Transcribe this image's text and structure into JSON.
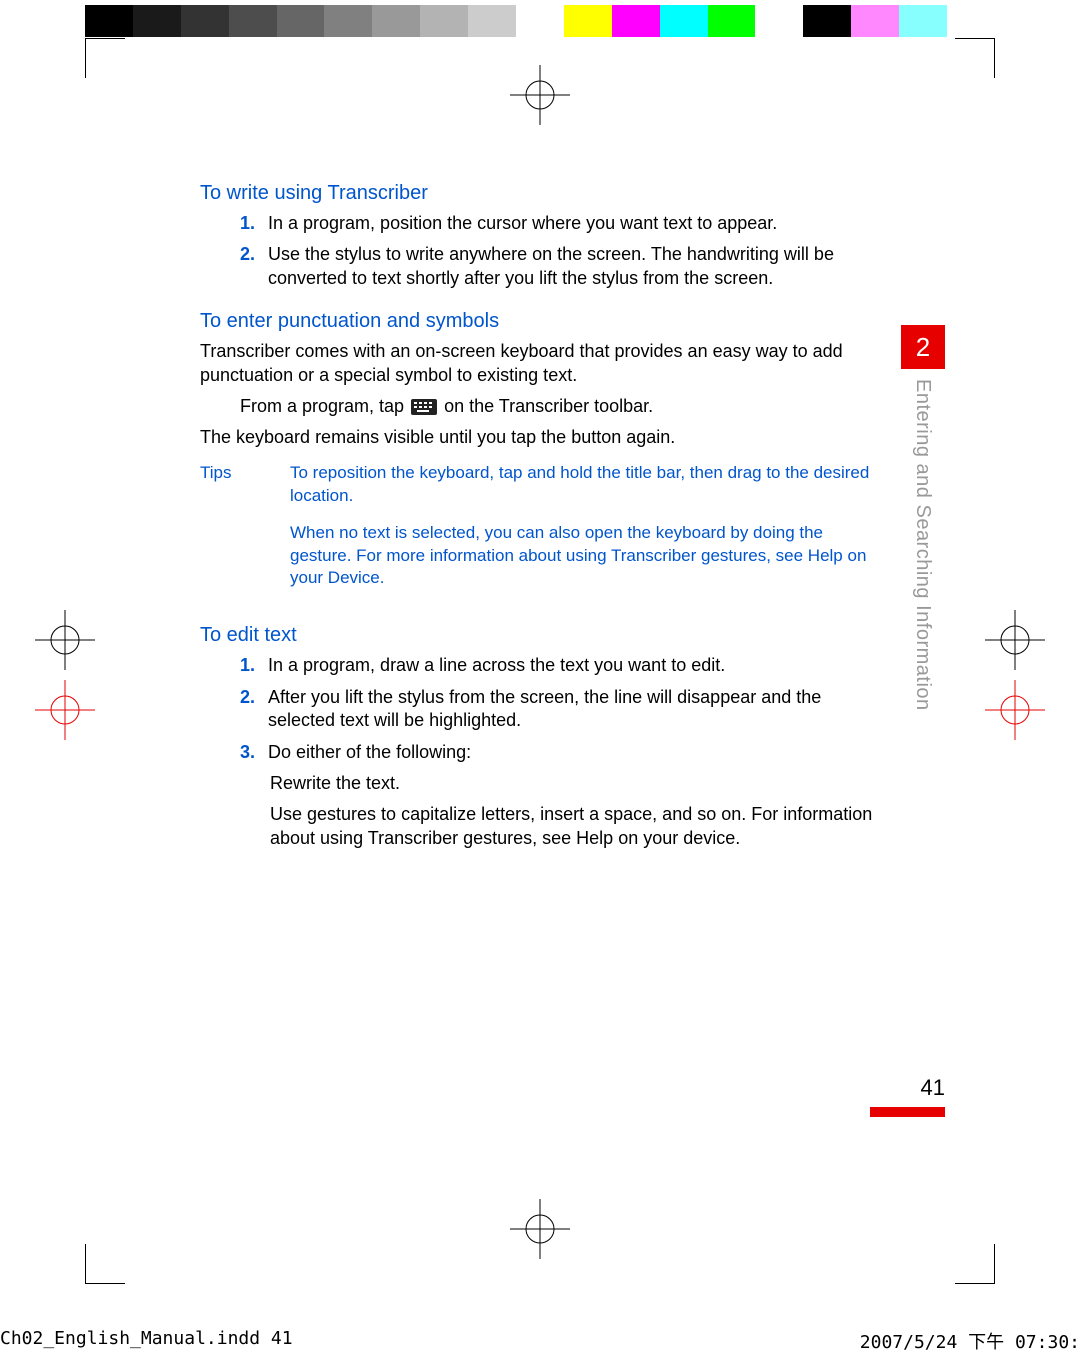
{
  "chapter": {
    "number": "2",
    "title": "Entering and Searching Information"
  },
  "page_number": "41",
  "slug": {
    "file": "Ch02_English_Manual.indd   41",
    "timestamp": "2007/5/24   下午 07:30:"
  },
  "sections": [
    {
      "heading": "To write using Transcriber",
      "steps": [
        "In a program, position the cursor where you want text to appear.",
        "Use the stylus to write anywhere on the screen. The handwriting will be converted to text shortly after you lift the stylus from the screen."
      ]
    },
    {
      "heading": "To enter punctuation and symbols",
      "intro": "Transcriber comes with an on-screen keyboard that provides an easy way to add punctuation or a special symbol to existing text.",
      "action_pre": "From a program, tap ",
      "action_post": " on the Transcriber toolbar.",
      "followup": "The keyboard remains visible until you tap the button again.",
      "tips_label": "Tips",
      "tips": [
        "To reposition the keyboard, tap and hold the title bar, then drag to the desired location.",
        "When no text is selected, you can also open the keyboard by doing the gesture. For more information about using Transcriber gestures, see Help on your Device."
      ]
    },
    {
      "heading": "To edit text",
      "steps": [
        "In a program, draw a line across the text you want to edit.",
        "After you lift the stylus from the screen, the line will disappear and the selected text will be highlighted.",
        "Do either of the following:"
      ],
      "subitems": [
        "Rewrite the text.",
        "Use gestures to capitalize letters, insert a space, and so on. For information about using Transcriber gestures, see Help on your device."
      ]
    }
  ],
  "colorbar": [
    "#000",
    "#1a1a1a",
    "#333",
    "#4d4d4d",
    "#666",
    "#808080",
    "#999",
    "#b3b3b3",
    "#ccc",
    "#fff",
    "#ff0",
    "#f0f",
    "#0ff",
    "#0f0",
    "#fff",
    "#000",
    "#f0f",
    "#0ff",
    "#fff"
  ]
}
